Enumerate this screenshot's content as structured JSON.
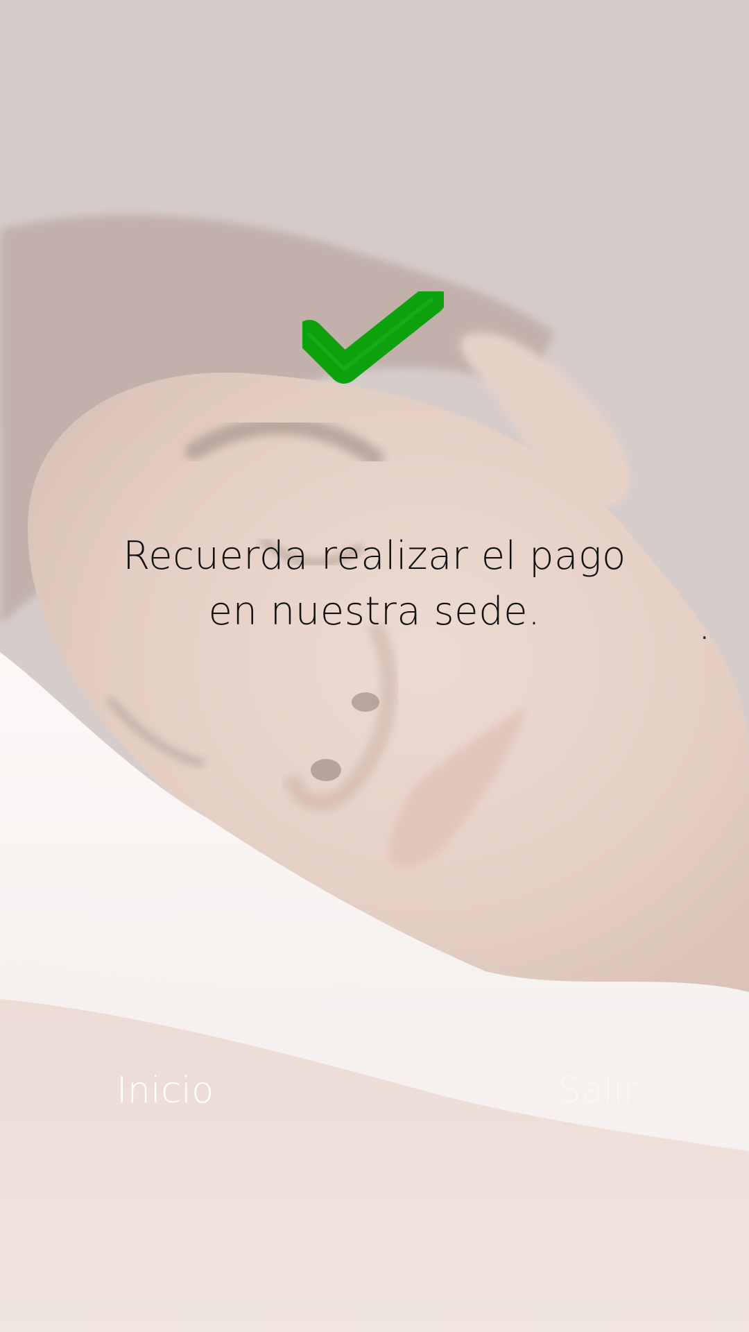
{
  "confirmation": {
    "icon": "check-icon",
    "icon_color": "#0ea10e",
    "message_line1": "Recuerda realizar el pago",
    "message_line2": "en nuestra sede.",
    "trailing_mark": "."
  },
  "nav": {
    "left_label": "Inicio",
    "right_label": "Salir"
  },
  "colors": {
    "overlay": "#f3ece8",
    "text_dark": "#111111",
    "nav_text": "#ffffff"
  }
}
